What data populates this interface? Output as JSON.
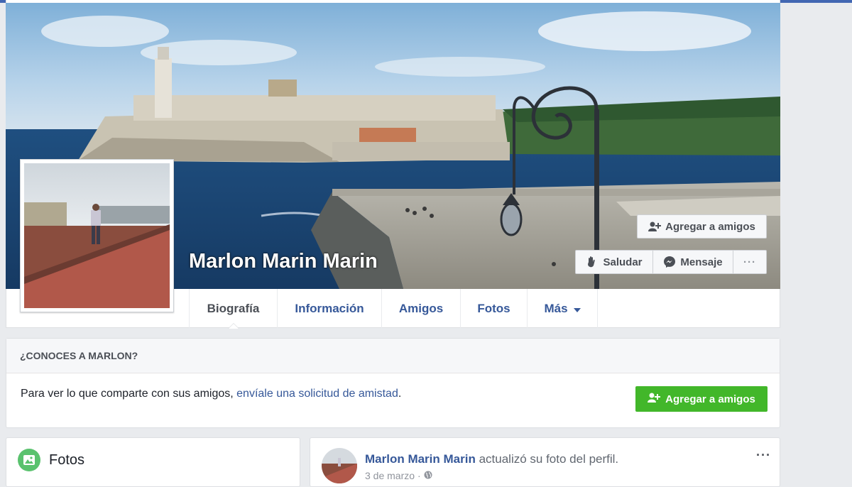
{
  "colors": {
    "brand_blue": "#4267b2",
    "link_blue": "#365899",
    "green_button": "#42b72a",
    "page_bg": "#e9ebee"
  },
  "profile": {
    "name": "Marlon Marin Marin"
  },
  "cover_actions": {
    "add_friend_label": "Agregar a amigos",
    "add_friend_icon": "add-friend-icon",
    "wave_label": "Saludar",
    "wave_icon": "wave-hand-icon",
    "message_label": "Mensaje",
    "message_icon": "messenger-icon",
    "more_label": "···"
  },
  "tabs": [
    {
      "label": "Biografía",
      "active": true
    },
    {
      "label": "Información"
    },
    {
      "label": "Amigos"
    },
    {
      "label": "Fotos"
    },
    {
      "label": "Más",
      "icon": "caret-down-icon"
    }
  ],
  "know_card": {
    "heading": "¿CONOCES A MARLON?",
    "text_before": "Para ver lo que comparte con sus amigos, ",
    "link_text": "envíale una solicitud de amistad",
    "text_after": ".",
    "button_label": "Agregar a amigos",
    "button_icon": "add-friend-icon"
  },
  "photos_card": {
    "title": "Fotos",
    "icon": "photos-icon"
  },
  "post": {
    "author": "Marlon Marin Marin",
    "action": " actualizó su foto del perfil.",
    "date": "3 de marzo",
    "separator": " · ",
    "privacy_icon": "globe-icon",
    "more_label": "···"
  }
}
